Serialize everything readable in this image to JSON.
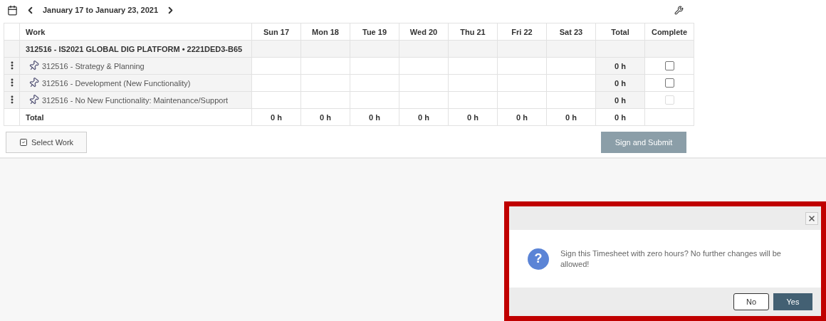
{
  "toolbar": {
    "date_range": "January 17 to January 23, 2021"
  },
  "table": {
    "columns": [
      "Work",
      "Sun 17",
      "Mon 18",
      "Tue 19",
      "Wed 20",
      "Thu 21",
      "Fri 22",
      "Sat 23",
      "Total",
      "Complete"
    ],
    "group": "312516 - IS2021 GLOBAL DIG PLATFORM • 2221DED3-B65",
    "rows": [
      {
        "work": "312516 - Strategy & Planning",
        "total": "0 h",
        "complete": {
          "checked": false,
          "disabled": false
        }
      },
      {
        "work": "312516 - Development (New Functionality)",
        "total": "0 h",
        "complete": {
          "checked": false,
          "disabled": false
        }
      },
      {
        "work": "312516 - No New Functionality: Maintenance/Support",
        "total": "0 h",
        "complete": {
          "checked": false,
          "disabled": true
        }
      }
    ],
    "total_row": {
      "label": "Total",
      "values": [
        "0 h",
        "0 h",
        "0 h",
        "0 h",
        "0 h",
        "0 h",
        "0 h",
        "0 h"
      ]
    }
  },
  "actions": {
    "select_work": "Select Work",
    "sign_submit": {
      "label": "Sign and Submit",
      "disabled": true
    }
  },
  "dialog": {
    "icon": "?",
    "message": "Sign this Timesheet with zero hours? No further changes will be allowed!",
    "buttons": [
      {
        "label": "No",
        "kind": "secondary"
      },
      {
        "label": "Yes",
        "kind": "primary"
      }
    ]
  }
}
